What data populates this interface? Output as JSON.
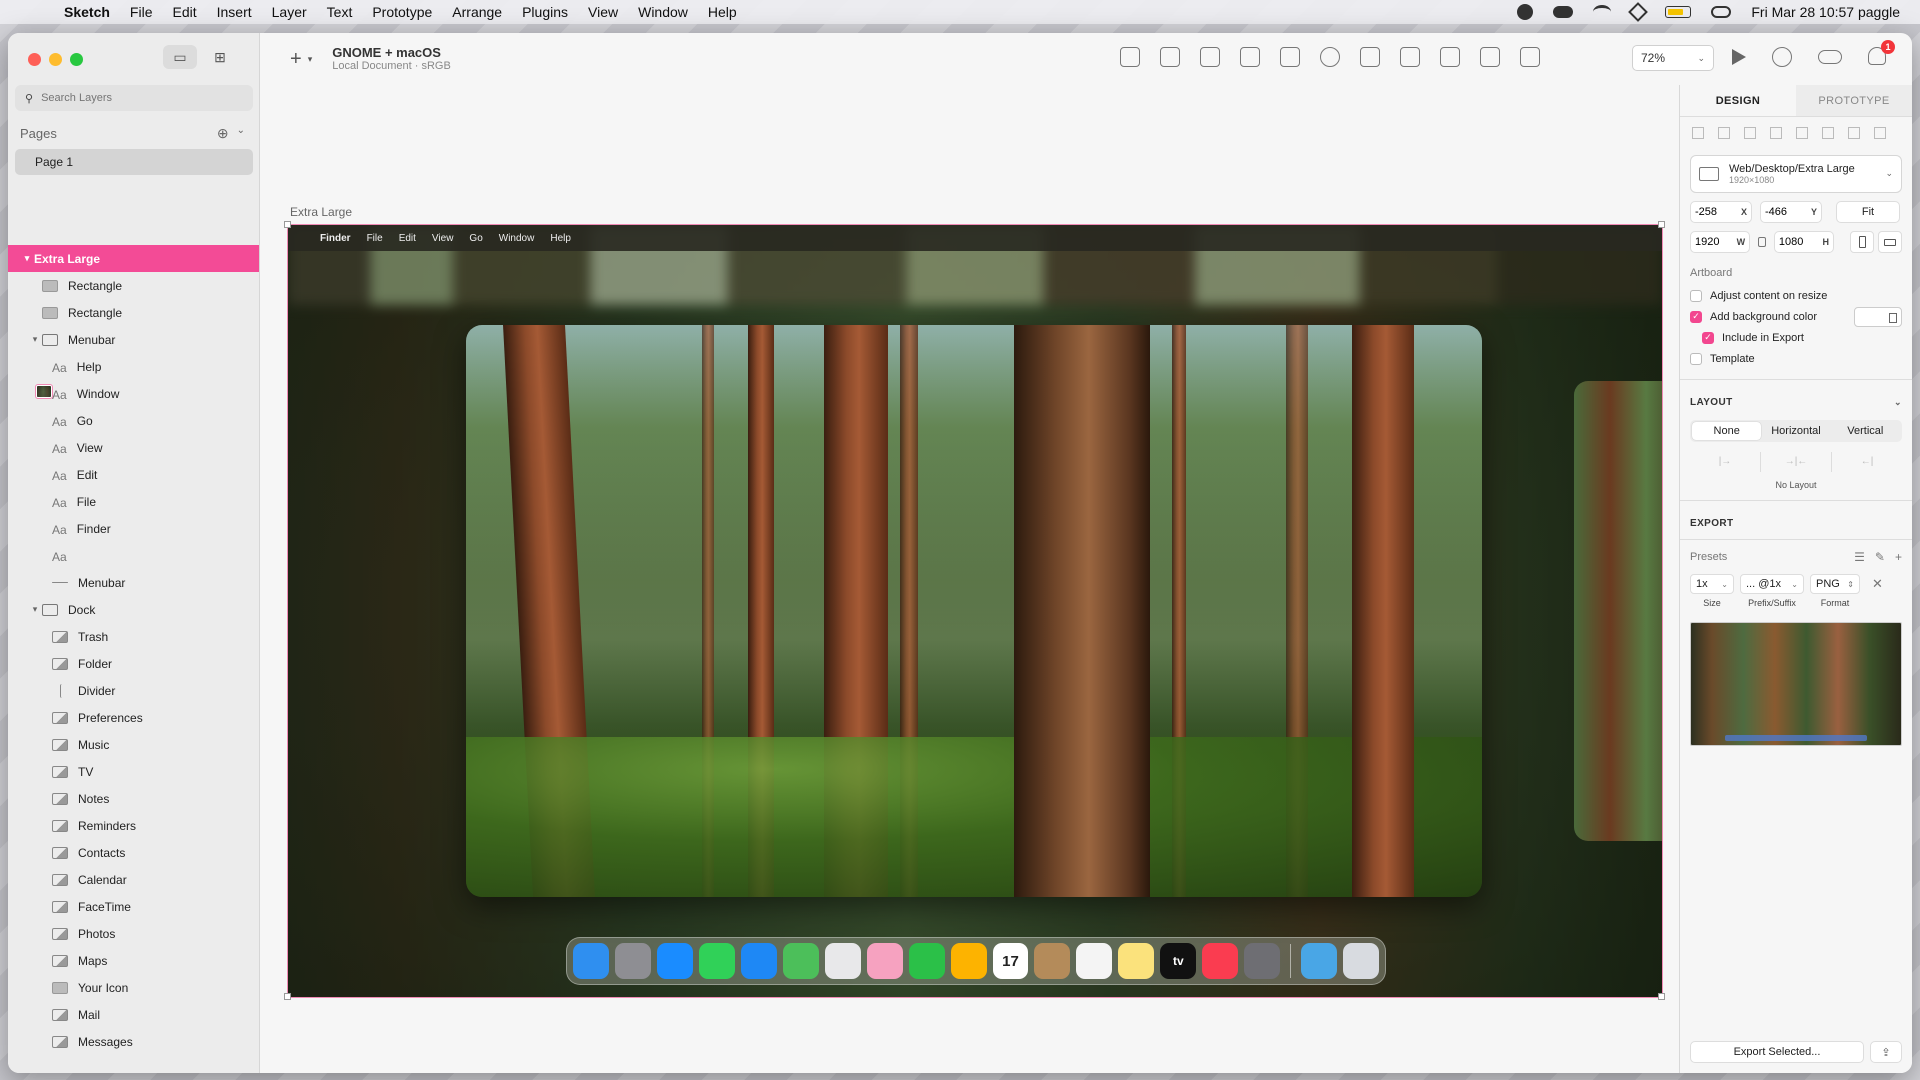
{
  "menubar": {
    "app": "Sketch",
    "items": [
      "File",
      "Edit",
      "Insert",
      "Layer",
      "Text",
      "Prototype",
      "Arrange",
      "Plugins",
      "View",
      "Window",
      "Help"
    ],
    "clock": "Fri Mar 28  10:57 paggle"
  },
  "sidebar": {
    "search_placeholder": "Search Layers",
    "pages_label": "Pages",
    "page": "Page 1",
    "layers": [
      {
        "label": "Extra Large",
        "icon": "artboard",
        "depth": 0,
        "chev": "▾",
        "selected": true
      },
      {
        "label": "Rectangle",
        "icon": "rect",
        "depth": 1
      },
      {
        "label": "Rectangle",
        "icon": "rect",
        "depth": 1
      },
      {
        "label": "Menubar",
        "icon": "folder",
        "depth": 1,
        "chev": "▾"
      },
      {
        "label": "Help",
        "icon": "text",
        "depth": 2
      },
      {
        "label": "Window",
        "icon": "text",
        "depth": 2
      },
      {
        "label": "Go",
        "icon": "text",
        "depth": 2
      },
      {
        "label": "View",
        "icon": "text",
        "depth": 2
      },
      {
        "label": "Edit",
        "icon": "text",
        "depth": 2
      },
      {
        "label": "File",
        "icon": "text",
        "depth": 2
      },
      {
        "label": "Finder",
        "icon": "text",
        "depth": 2
      },
      {
        "label": "",
        "icon": "text",
        "depth": 2,
        "apple": true
      },
      {
        "label": "Menubar",
        "icon": "line",
        "depth": 2
      },
      {
        "label": "Dock",
        "icon": "folder",
        "depth": 1,
        "chev": "▾"
      },
      {
        "label": "Trash",
        "icon": "image",
        "depth": 2
      },
      {
        "label": "Folder",
        "icon": "image",
        "depth": 2
      },
      {
        "label": "Divider",
        "icon": "vline",
        "depth": 2
      },
      {
        "label": "Preferences",
        "icon": "image",
        "depth": 2
      },
      {
        "label": "Music",
        "icon": "image",
        "depth": 2
      },
      {
        "label": "TV",
        "icon": "image",
        "depth": 2,
        "apple": true
      },
      {
        "label": "Notes",
        "icon": "image",
        "depth": 2
      },
      {
        "label": "Reminders",
        "icon": "image",
        "depth": 2
      },
      {
        "label": "Contacts",
        "icon": "image",
        "depth": 2
      },
      {
        "label": "Calendar",
        "icon": "image",
        "depth": 2
      },
      {
        "label": "FaceTime",
        "icon": "image",
        "depth": 2
      },
      {
        "label": "Photos",
        "icon": "image",
        "depth": 2
      },
      {
        "label": "Maps",
        "icon": "image",
        "depth": 2
      },
      {
        "label": "Your Icon",
        "icon": "rect",
        "depth": 2
      },
      {
        "label": "Mail",
        "icon": "image",
        "depth": 2
      },
      {
        "label": "Messages",
        "icon": "image",
        "depth": 2
      }
    ]
  },
  "toolbar": {
    "doc_title": "GNOME + macOS",
    "doc_subtitle": "Local Document · sRGB",
    "zoom": "72%",
    "notification_count": "1"
  },
  "canvas": {
    "artboard_label": "Extra Large",
    "artboard_menubar": [
      "Finder",
      "File",
      "Edit",
      "View",
      "Go",
      "Window",
      "Help"
    ],
    "dock_icons": [
      {
        "name": "finder",
        "color": "#2f8ff0"
      },
      {
        "name": "launchpad",
        "color": "#8e8e93"
      },
      {
        "name": "safari",
        "color": "#1a8cff"
      },
      {
        "name": "messages",
        "color": "#30d158"
      },
      {
        "name": "mail",
        "color": "#1e88f5"
      },
      {
        "name": "maps",
        "color": "#4cbf5a"
      },
      {
        "name": "downloads",
        "color": "#e8e8ea"
      },
      {
        "name": "photos",
        "color": "#f6a2c0"
      },
      {
        "name": "facetime",
        "color": "#2bc048"
      },
      {
        "name": "sketch",
        "color": "#fdb300"
      },
      {
        "name": "calendar",
        "color": "#ffffff",
        "text": "17"
      },
      {
        "name": "contacts",
        "color": "#b48b5a"
      },
      {
        "name": "reminders",
        "color": "#f4f4f4"
      },
      {
        "name": "notes",
        "color": "#fbe27c"
      },
      {
        "name": "tv",
        "color": "#111111",
        "text": "tv"
      },
      {
        "name": "music",
        "color": "#fa3c50"
      },
      {
        "name": "settings",
        "color": "#6e6e73"
      },
      {
        "name": "divider"
      },
      {
        "name": "folder",
        "color": "#49a6e6"
      },
      {
        "name": "trash",
        "color": "#d8dbe0"
      }
    ]
  },
  "inspector": {
    "tabs": [
      "DESIGN",
      "PROTOTYPE"
    ],
    "preset_name": "Web/Desktop/Extra Large",
    "preset_size": "1920×1080",
    "x": "-258",
    "y": "-466",
    "w": "1920",
    "h": "1080",
    "fit": "Fit",
    "artboard_label": "Artboard",
    "adjust_content": "Adjust content on resize",
    "add_bg": "Add background color",
    "include_export": "Include in Export",
    "template": "Template",
    "layout_label": "LAYOUT",
    "layout_options": [
      "None",
      "Horizontal",
      "Vertical"
    ],
    "no_layout": "No Layout",
    "export_label": "EXPORT",
    "presets_label": "Presets",
    "size": "1x",
    "suffix": "... @1x",
    "format": "PNG",
    "size_label": "Size",
    "suffix_label": "Prefix/Suffix",
    "format_label": "Format",
    "export_selected": "Export Selected..."
  },
  "colors": {
    "accent": "#f34b96",
    "badge": "#f2353a"
  }
}
